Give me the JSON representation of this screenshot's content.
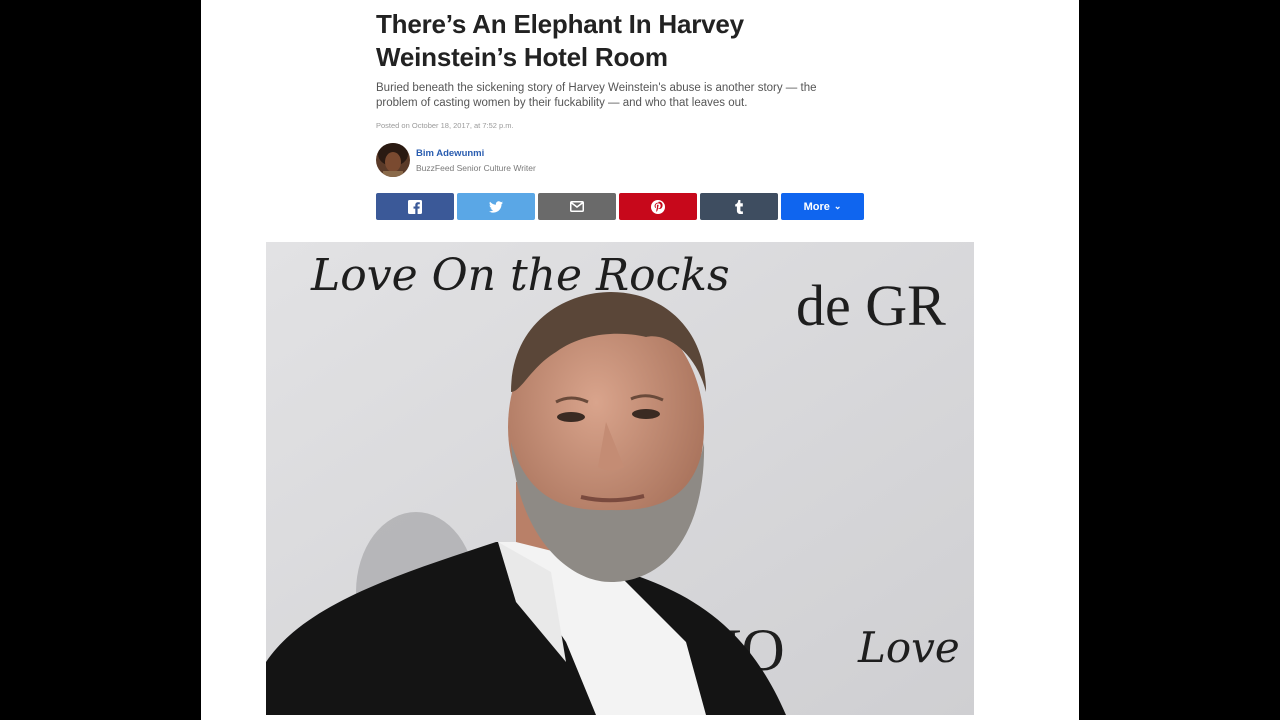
{
  "article": {
    "headline": "There’s An Elephant In Harvey Weinstein’s Hotel Room",
    "dek": "Buried beneath the sickening story of Harvey Weinstein's abuse is another story — the problem of casting women by their fuckability — and who that leaves out.",
    "posted": "Posted on October 18, 2017, at 7:52 p.m."
  },
  "author": {
    "name": "Bim Adewunmi",
    "title": "BuzzFeed Senior Culture Writer",
    "avatar_icon": "author-avatar-photo"
  },
  "share": {
    "buttons": [
      {
        "network": "facebook",
        "icon": "facebook-icon",
        "color": "#3b5998"
      },
      {
        "network": "twitter",
        "icon": "twitter-icon",
        "color": "#5aa7e6"
      },
      {
        "network": "email",
        "icon": "email-icon",
        "color": "#6a6a6a"
      },
      {
        "network": "pinterest",
        "icon": "pinterest-icon",
        "color": "#c7081b"
      },
      {
        "network": "tumblr",
        "icon": "tumblr-icon",
        "color": "#3e4d60"
      }
    ],
    "more_label": "More",
    "more_color": "#0f65ef",
    "more_icon": "chevron-down-icon"
  },
  "hero": {
    "backdrop_text_1": "Love On the Rocks",
    "backdrop_text_2": "de GR",
    "backdrop_text_3": "NO",
    "backdrop_text_4": "Love O"
  },
  "colors": {
    "headline": "#222222",
    "author_link": "#2a5db0",
    "page_bg": "#ffffff",
    "frame_bg": "#000000"
  }
}
